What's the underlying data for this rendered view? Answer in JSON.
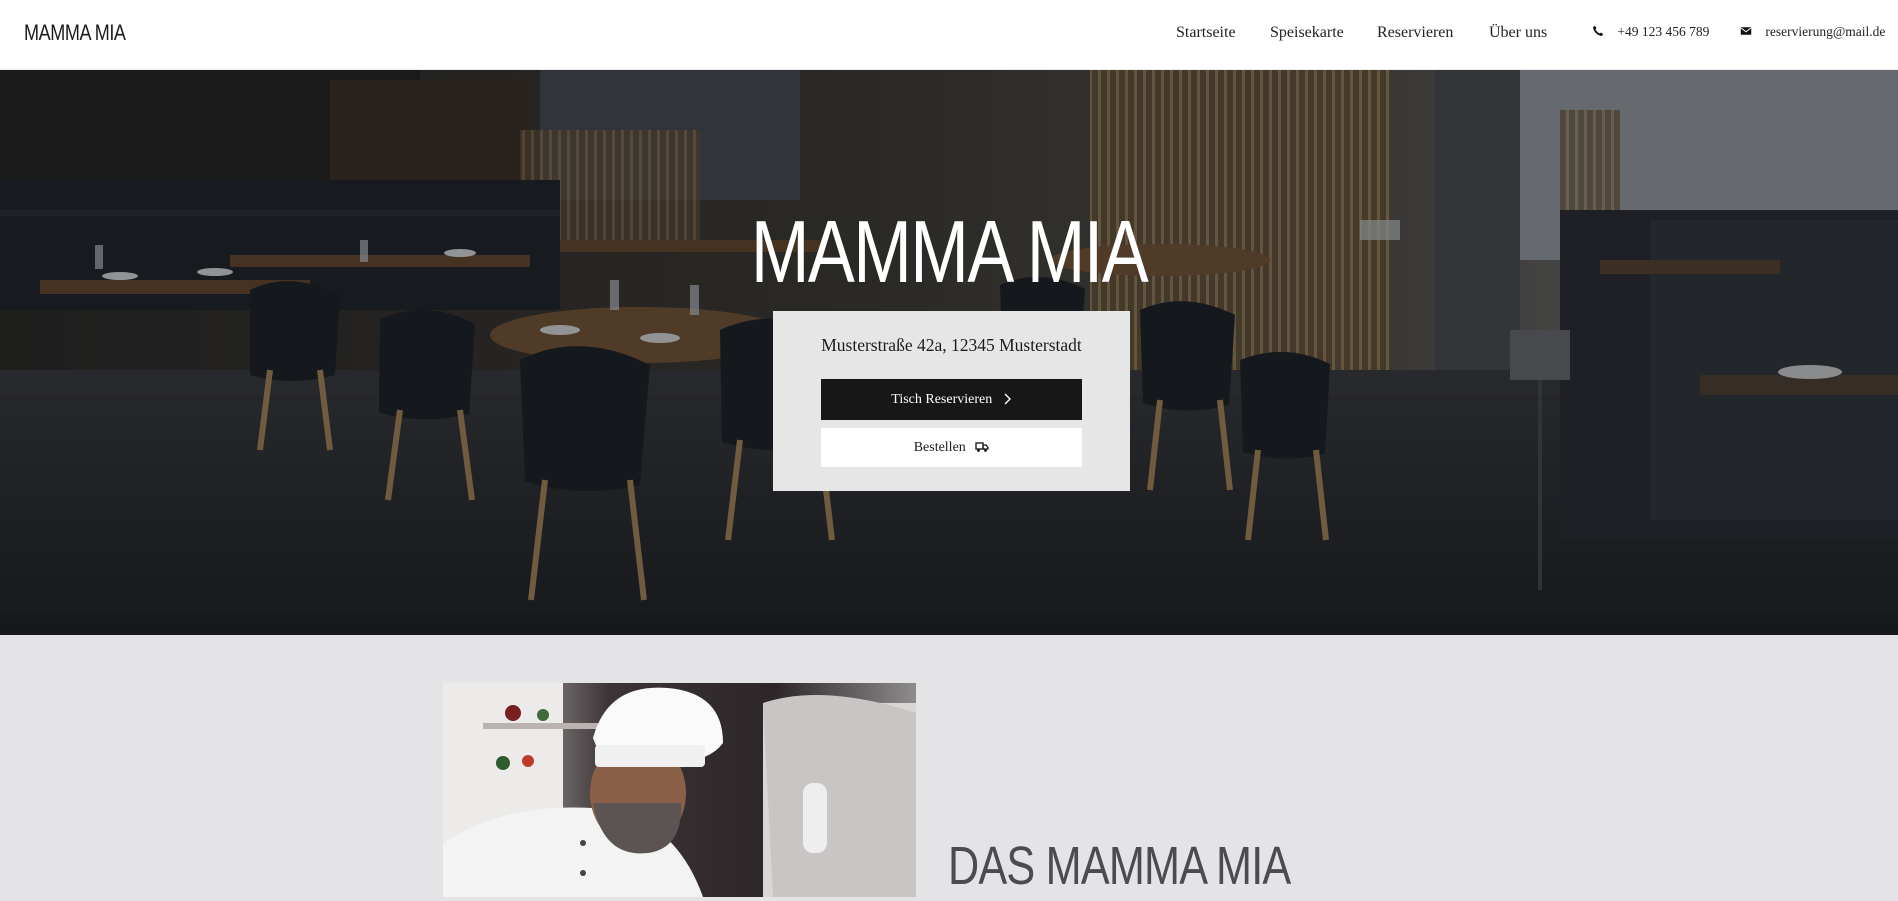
{
  "header": {
    "logo": "MAMMA MIA",
    "nav": [
      {
        "label": "Startseite"
      },
      {
        "label": "Speisekarte"
      },
      {
        "label": "Reservieren"
      },
      {
        "label": "Über uns"
      }
    ],
    "phone": "+49 123 456 789",
    "email": "reservierung@mail.de"
  },
  "hero": {
    "title": "MAMMA MIA",
    "address": "Musterstraße 42a, 12345 Musterstadt",
    "reserve_button": "Tisch Reservieren",
    "order_button": "Bestellen"
  },
  "about": {
    "title": "DAS MAMMA MIA"
  },
  "icons": {
    "phone": "phone-icon",
    "email": "envelope-icon",
    "chevron": "chevron-right-icon",
    "delivery": "delivery-truck-icon"
  },
  "colors": {
    "header_bg": "#ffffff",
    "section_bg": "#e4e4e7",
    "card_bg": "#e6e6e7",
    "button_dark": "#171717",
    "button_light": "#ffffff",
    "heading_gray": "#4b4b50"
  }
}
